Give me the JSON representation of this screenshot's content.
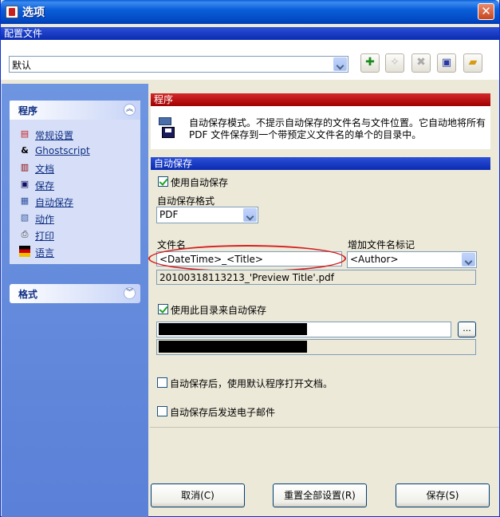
{
  "window": {
    "title": "选项",
    "close": "✕"
  },
  "profile": {
    "section_label": "配置文件",
    "selected": "默认",
    "tools": [
      "add-icon",
      "star-icon",
      "delete-icon",
      "save-icon",
      "folder-icon"
    ]
  },
  "sidebar": {
    "program_panel": {
      "title": "程序",
      "items": [
        {
          "label": "常规设置",
          "icon": "settings-icon"
        },
        {
          "label": "Ghostscript",
          "icon": "ghostscript-icon"
        },
        {
          "label": "文档",
          "icon": "document-icon"
        },
        {
          "label": "保存",
          "icon": "floppy-icon"
        },
        {
          "label": "自动保存",
          "icon": "autosave-icon"
        },
        {
          "label": "动作",
          "icon": "action-icon"
        },
        {
          "label": "打印",
          "icon": "printer-icon"
        },
        {
          "label": "语言",
          "icon": "flag-icon"
        }
      ]
    },
    "format_panel": {
      "title": "格式"
    }
  },
  "program_section": {
    "title": "程序",
    "description_line1": "自动保存模式。不提示自动保存的文件名与文件位置。它自动地将所有",
    "description_line2": "PDF 文件保存到一个带预定义文件名的单个的目录中。"
  },
  "autosave_section": {
    "title": "自动保存",
    "use_autosave_label": "使用自动保存",
    "use_autosave_checked": true,
    "format_label": "自动保存格式",
    "format_value": "PDF",
    "filename_label": "文件名",
    "filename_value": "<DateTime>_<Title>",
    "add_token_label": "增加文件名标记",
    "add_token_value": "<Author>",
    "preview_value": "20100318113213_'Preview Title'.pdf",
    "use_dir_label": "使用此目录来自动保存",
    "use_dir_checked": true,
    "browse_label": "...",
    "open_after_label": "自动保存后，使用默认程序打开文档。",
    "open_after_checked": false,
    "email_label": "自动保存后发送电子邮件",
    "email_checked": false
  },
  "buttons": {
    "cancel": "取消(C)",
    "reset": "重置全部设置(R)",
    "save": "保存(S)"
  }
}
